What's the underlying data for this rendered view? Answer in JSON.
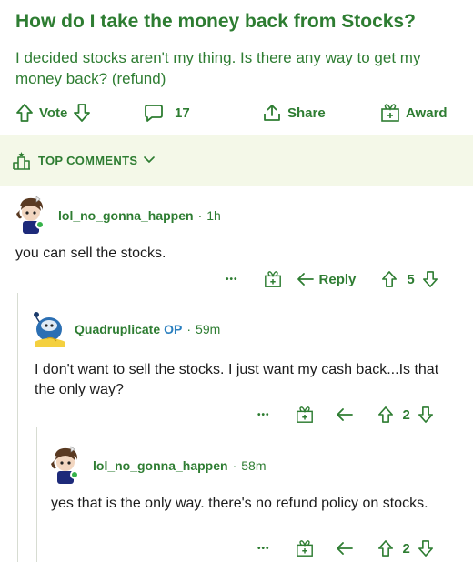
{
  "post": {
    "title": "How do I take the money back from Stocks?",
    "body": "I decided stocks aren't my thing. Is there any way to get my money back? (refund)",
    "vote_label": "Vote",
    "comment_count": "17",
    "share_label": "Share",
    "award_label": "Award"
  },
  "sort": {
    "label": "TOP COMMENTS"
  },
  "comments": [
    {
      "username": "lol_no_gonna_happen",
      "op_badge": "",
      "time": "1h",
      "body": "you can sell the stocks.",
      "more": "•••",
      "reply_label": "Reply",
      "score": "5"
    },
    {
      "username": "Quadruplicate",
      "op_badge": "OP",
      "time": "59m",
      "body": "I don't want to sell the stocks. I just want my cash back...Is that the only way?",
      "more": "•••",
      "score": "2"
    },
    {
      "username": "lol_no_gonna_happen",
      "op_badge": "",
      "time": "58m",
      "body": "yes that is the only way.  there's no refund policy on stocks.",
      "more": "•••",
      "score": "2"
    }
  ],
  "theme": {
    "accent": "#2e7d32",
    "op_blue": "#2a7fbf",
    "banner_bg": "#f4f8e8"
  }
}
